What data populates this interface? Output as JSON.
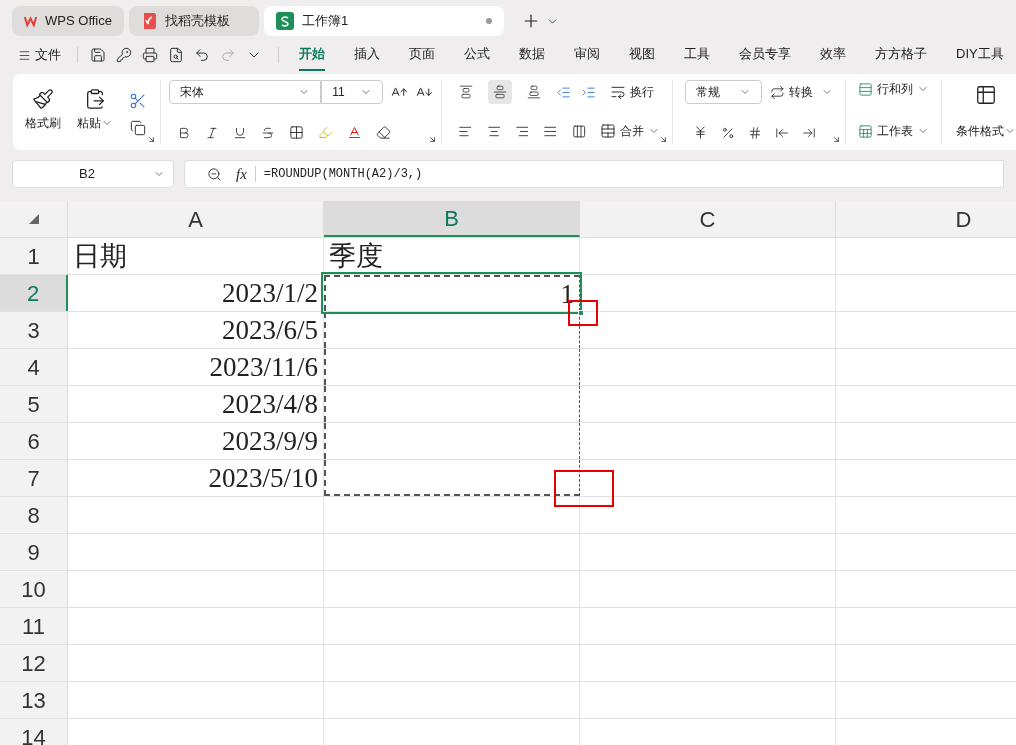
{
  "tabs": [
    {
      "label": "WPS Office",
      "kind": "home",
      "selected": false
    },
    {
      "label": "找稻壳模板",
      "kind": "template",
      "selected": false
    },
    {
      "label": "工作簿1",
      "kind": "sheet",
      "selected": true,
      "unsaved": true
    }
  ],
  "menu": {
    "file": "文件",
    "items": [
      {
        "label": "开始",
        "selected": true
      },
      {
        "label": "插入",
        "selected": false
      },
      {
        "label": "页面",
        "selected": false
      },
      {
        "label": "公式",
        "selected": false
      },
      {
        "label": "数据",
        "selected": false
      },
      {
        "label": "审阅",
        "selected": false
      },
      {
        "label": "视图",
        "selected": false
      },
      {
        "label": "工具",
        "selected": false
      },
      {
        "label": "会员专享",
        "selected": false
      },
      {
        "label": "效率",
        "selected": false
      },
      {
        "label": "方方格子",
        "selected": false
      },
      {
        "label": "DIY工具",
        "selected": false
      }
    ]
  },
  "ribbon": {
    "format_painter": "格式刷",
    "paste": "粘贴",
    "font_name": "宋体",
    "font_size": "11",
    "vertical_align": [
      {
        "selected": false
      },
      {
        "selected": true
      },
      {
        "selected": false
      }
    ],
    "wrap": "换行",
    "merge": "合并",
    "number_format": "常规",
    "convert": "转换",
    "rows_cols": "行和列",
    "worksheet": "工作表",
    "conditional_format": "条件格式"
  },
  "formula_bar": {
    "name_box": "B2",
    "function_label": "fx",
    "formula": "=ROUNDUP(MONTH(A2)/3,)"
  },
  "columns": [
    {
      "label": "A",
      "selected": false
    },
    {
      "label": "B",
      "selected": true
    },
    {
      "label": "C",
      "selected": false
    },
    {
      "label": "D",
      "selected": false
    }
  ],
  "rows": [
    {
      "header": "1",
      "selected": false,
      "cells": [
        {
          "value": "日期",
          "kind": "text"
        },
        {
          "value": "季度",
          "kind": "text"
        }
      ]
    },
    {
      "header": "2",
      "selected": true,
      "cells": [
        {
          "value": "2023/1/2",
          "kind": "number"
        },
        {
          "value": "1",
          "kind": "number",
          "active": true,
          "copied": true
        }
      ]
    },
    {
      "header": "3",
      "selected": false,
      "cells": [
        {
          "value": "2023/6/5",
          "kind": "number"
        },
        {
          "copied": true
        }
      ]
    },
    {
      "header": "4",
      "selected": false,
      "cells": [
        {
          "value": "2023/11/6",
          "kind": "number"
        },
        {
          "copied": true
        }
      ]
    },
    {
      "header": "5",
      "selected": false,
      "cells": [
        {
          "value": "2023/4/8",
          "kind": "number"
        },
        {
          "copied": true
        }
      ]
    },
    {
      "header": "6",
      "selected": false,
      "cells": [
        {
          "value": "2023/9/9",
          "kind": "number"
        },
        {
          "copied": true
        }
      ]
    },
    {
      "header": "7",
      "selected": false,
      "cells": [
        {
          "value": "2023/5/10",
          "kind": "number"
        },
        {
          "copied": true
        }
      ]
    },
    {
      "header": "8",
      "selected": false,
      "cells": []
    },
    {
      "header": "9",
      "selected": false,
      "cells": []
    },
    {
      "header": "10",
      "selected": false,
      "cells": []
    },
    {
      "header": "11",
      "selected": false,
      "cells": []
    },
    {
      "header": "12",
      "selected": false,
      "cells": []
    },
    {
      "header": "13",
      "selected": false,
      "cells": []
    },
    {
      "header": "14",
      "selected": false,
      "cells": []
    }
  ],
  "annotations": [
    {
      "kind": "highlight-box"
    },
    {
      "kind": "highlight-box"
    }
  ]
}
